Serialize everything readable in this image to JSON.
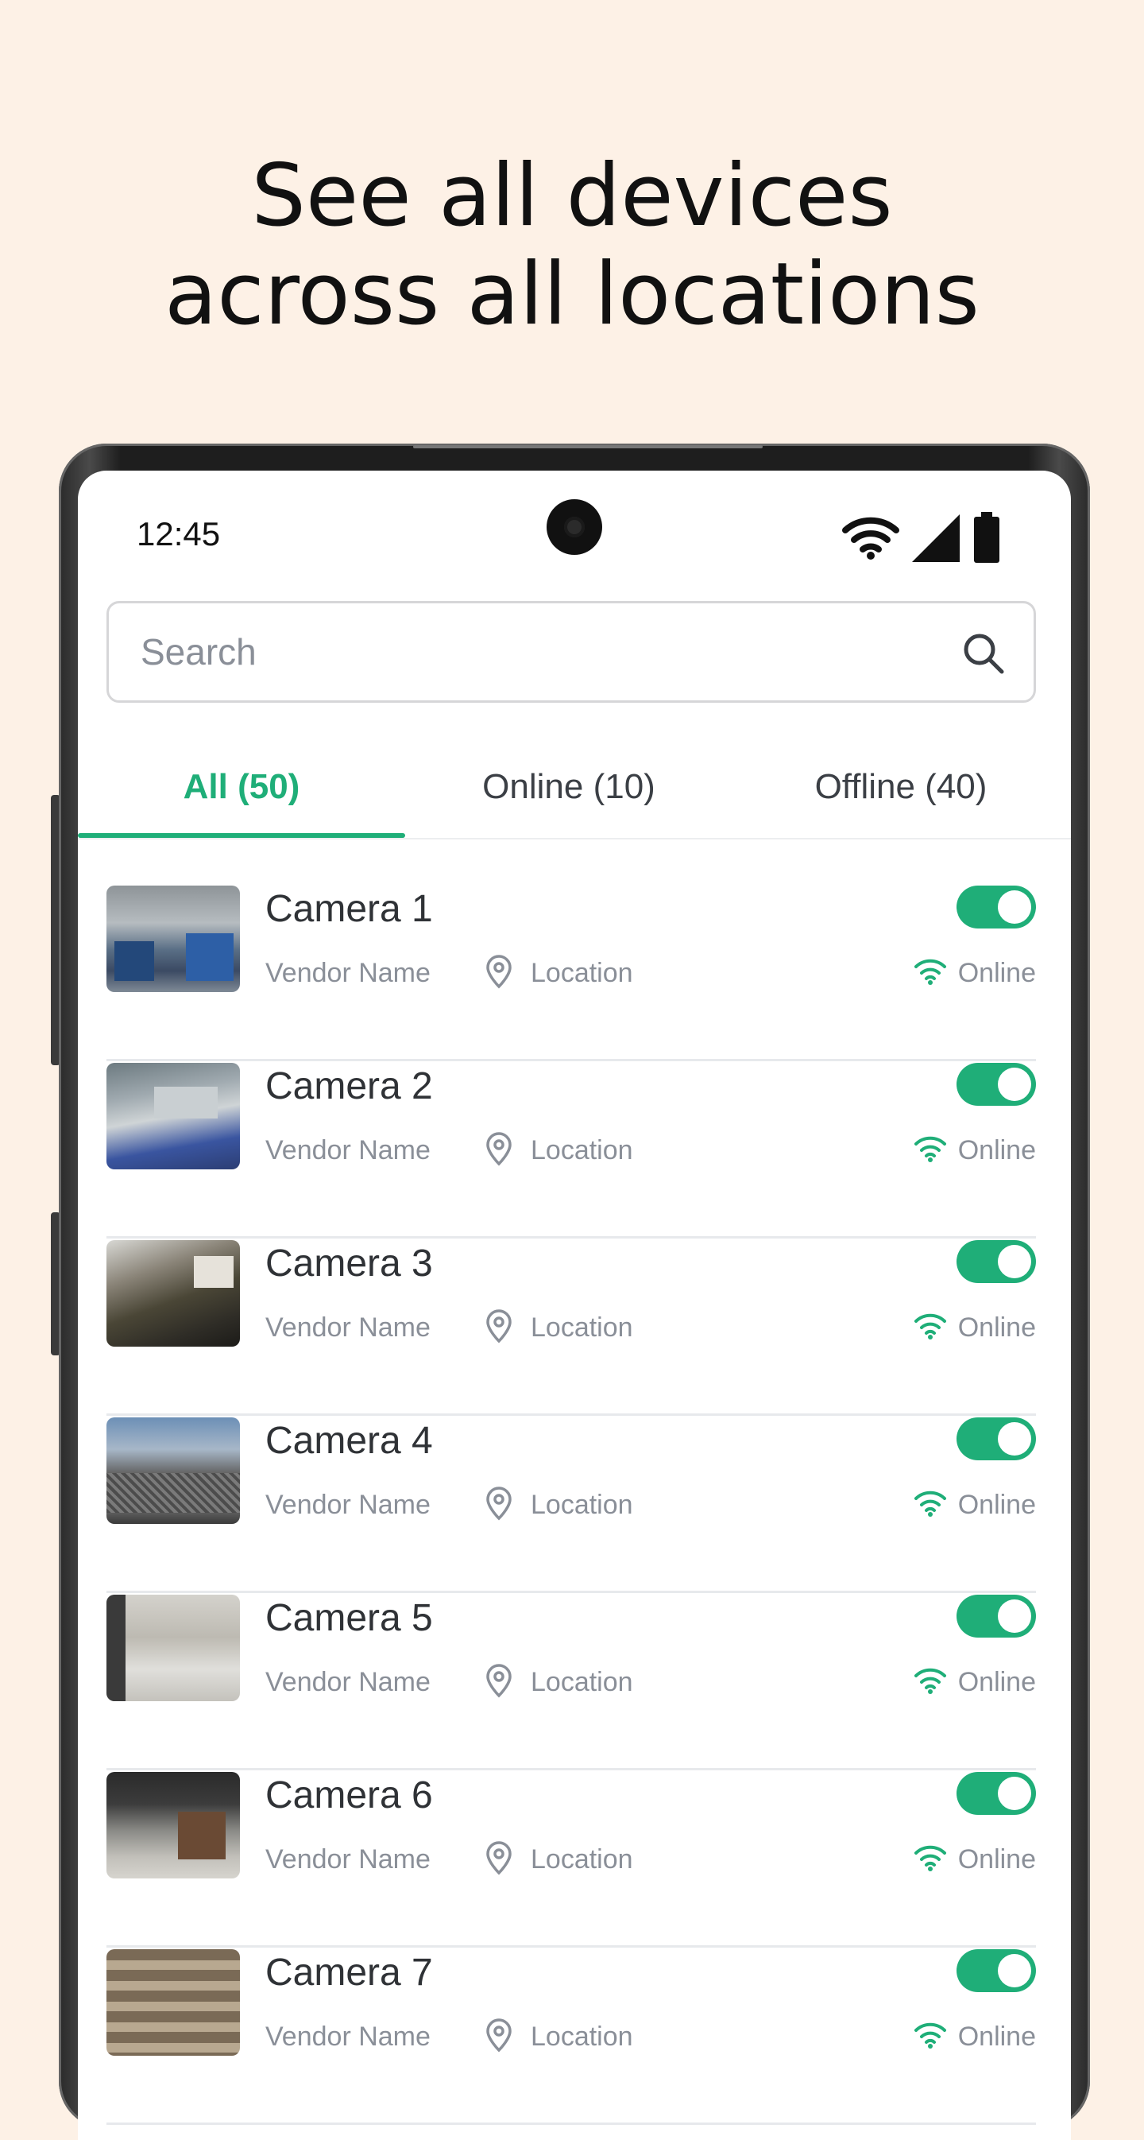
{
  "headline": {
    "line1": "See all devices",
    "line2": "across all locations"
  },
  "status_bar": {
    "time": "12:45",
    "icons": [
      "wifi-icon",
      "signal-icon",
      "battery-icon"
    ]
  },
  "search": {
    "placeholder": "Search",
    "value": ""
  },
  "tabs": [
    {
      "label": "All (50)",
      "active": true
    },
    {
      "label": "Online (10)",
      "active": false
    },
    {
      "label": "Offline (40)",
      "active": false
    }
  ],
  "cameras": [
    {
      "name": "Camera 1",
      "vendor": "Vendor Name",
      "location": "Location",
      "status": "Online",
      "enabled": true
    },
    {
      "name": "Camera 2",
      "vendor": "Vendor Name",
      "location": "Location",
      "status": "Online",
      "enabled": true
    },
    {
      "name": "Camera 3",
      "vendor": "Vendor Name",
      "location": "Location",
      "status": "Online",
      "enabled": true
    },
    {
      "name": "Camera 4",
      "vendor": "Vendor Name",
      "location": "Location",
      "status": "Online",
      "enabled": true
    },
    {
      "name": "Camera 5",
      "vendor": "Vendor Name",
      "location": "Location",
      "status": "Online",
      "enabled": true
    },
    {
      "name": "Camera 6",
      "vendor": "Vendor Name",
      "location": "Location",
      "status": "Online",
      "enabled": true
    },
    {
      "name": "Camera 7",
      "vendor": "Vendor Name",
      "location": "Location",
      "status": "Online",
      "enabled": true
    }
  ],
  "colors": {
    "accent": "#1fae78",
    "background": "#fdf1e6",
    "muted_text": "#8a8f98"
  }
}
